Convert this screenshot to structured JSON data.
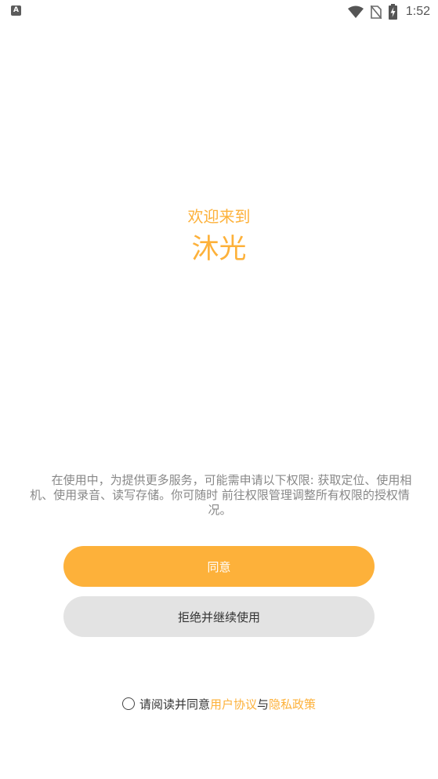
{
  "status_bar": {
    "app_icon_letter": "A",
    "time": "1:52",
    "icons": [
      "wifi-icon",
      "no-sim-icon",
      "battery-charging-icon"
    ]
  },
  "welcome": {
    "greeting": "欢迎来到",
    "app_name": "沐光"
  },
  "permission_notice": "在使用中，为提供更多服务，可能需申请以下权限: 获取定位、使用相机、使用录音、读写存储。你可随时 前往权限管理调整所有权限的授权情况。",
  "buttons": {
    "agree": "同意",
    "decline": "拒绝并继续使用"
  },
  "agreement": {
    "prefix": "请阅读并同意",
    "user_agreement": "用户协议",
    "conjunction": "与",
    "privacy_policy": "隐私政策",
    "checked": false
  },
  "colors": {
    "accent": "#fdb13a",
    "decline_bg": "#e3e3e3",
    "notice_text": "#888888"
  }
}
